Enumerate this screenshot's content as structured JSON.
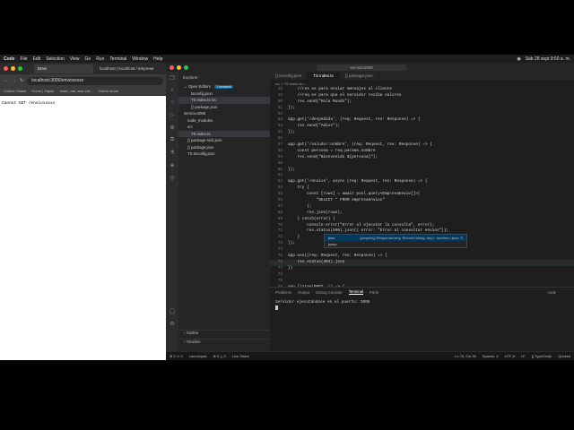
{
  "menubar": {
    "items": [
      "Code",
      "File",
      "Edit",
      "Selection",
      "View",
      "Go",
      "Run",
      "Terminal",
      "Window",
      "Help"
    ],
    "clock": "Sáb 28 sept 9:50 a. m."
  },
  "browser": {
    "tabs": [
      "Error",
      "localhost | localhost / emprese"
    ],
    "url": "localhost:3000/envioxxxxx",
    "bookmarks": [
      "Culture Shake",
      "Home | Zapier",
      "react, vue, and coll...",
      "Check mode"
    ],
    "page_text": "Cannot GET /envioxxxxx"
  },
  "vscode": {
    "search": "servicio4069",
    "explorer_title": "Explorer",
    "open_editors": "Open Editors",
    "open_editors_badge": "1 unsaved",
    "tree": [
      {
        "label": "tsconfig.json",
        "indent": 14
      },
      {
        "label": "TS index.ts src",
        "indent": 14,
        "selected": true
      },
      {
        "label": "{} package.json",
        "indent": 14
      },
      {
        "label": "servicio4069",
        "indent": 6
      },
      {
        "label": "node_modules",
        "indent": 10
      },
      {
        "label": "src",
        "indent": 10
      },
      {
        "label": "TS index.ts",
        "indent": 14,
        "selected": true
      },
      {
        "label": "{} package-lock.json",
        "indent": 10
      },
      {
        "label": "{} package.json",
        "indent": 10
      },
      {
        "label": "TS tsconfig.json",
        "indent": 10
      }
    ],
    "outline": "Outline",
    "timeline": "Timeline",
    "editor_tabs": [
      "{} tsconfig.json",
      "TS index.ts",
      "{} package.json"
    ],
    "breadcrumb": "src > TS index.ts > ...",
    "code_lines": [
      {
        "n": "48",
        "t": "    //res es para enviar mensajes al cliente"
      },
      {
        "n": "49",
        "t": "    //req es para que el servidor reciba valores"
      },
      {
        "n": "50",
        "t": "    res.send(\"Hola Mundo\");"
      },
      {
        "n": "51",
        "t": "});"
      },
      {
        "n": "52",
        "t": ""
      },
      {
        "n": "53",
        "t": "app.get('/despedida', (req: Request, res: Response) => {"
      },
      {
        "n": "54",
        "t": "    res.send(\"Adios\");"
      },
      {
        "n": "55",
        "t": "});"
      },
      {
        "n": "56",
        "t": ""
      },
      {
        "n": "57",
        "t": "app.get('/saludo/:nombre', (req: Request, res: Response) => {"
      },
      {
        "n": "58",
        "t": "    const persona = req.params.nombre"
      },
      {
        "n": "59",
        "t": "    res.send(\"Bienvenido ${persona}\");"
      },
      {
        "n": "60",
        "t": ""
      },
      {
        "n": "61",
        "t": "});"
      },
      {
        "n": "62",
        "t": ""
      },
      {
        "n": "63",
        "t": "app.get('/envios', async (req: Request, res: Response) => {"
      },
      {
        "n": "64",
        "t": "    try {"
      },
      {
        "n": "65",
        "t": "        const [rows] = await pool.query<EmpresaEnvio[]>("
      },
      {
        "n": "66",
        "t": "            \"SELECT * FROM empresaenvios\""
      },
      {
        "n": "67",
        "t": "        );"
      },
      {
        "n": "68",
        "t": "        res.json(rows);"
      },
      {
        "n": "69",
        "t": "    } catch(error) {"
      },
      {
        "n": "70",
        "t": "        console.error(\"Error al ejecutar la consulta\", error);"
      },
      {
        "n": "71",
        "t": "        res.status(500).json({ error: \"Error al consultar envios\"});"
      },
      {
        "n": "72",
        "t": "    }"
      },
      {
        "n": "73",
        "t": "});"
      },
      {
        "n": "74",
        "t": ""
      },
      {
        "n": "75",
        "t": "app.use((req: Request, res: Response) => {"
      },
      {
        "n": "76",
        "t": "    res.status(404).json"
      },
      {
        "n": "77",
        "t": "})"
      },
      {
        "n": "78",
        "t": ""
      },
      {
        "n": "79",
        "t": ""
      },
      {
        "n": "80",
        "t": "app.listen(PORT, () => {"
      },
      {
        "n": "81",
        "t": "    console.log(`Servidor ejecutándose en el puerto: ${PORT}`);"
      },
      {
        "n": "82",
        "t": "});"
      }
    ],
    "suggest": [
      {
        "label": "json",
        "detail": "(property) Response<any, Record<string, any>, number>.json: S"
      },
      {
        "label": "jsonp",
        "detail": ""
      }
    ],
    "panel_tabs": [
      "Problems",
      "Output",
      "Debug Console",
      "Terminal",
      "Ports"
    ],
    "active_panel_tab": "Terminal",
    "terminal_shell": "node",
    "terminal_output": "Servidor ejecutándose en el puerto: 3000",
    "status": {
      "left": [
        "⊗ 0 ⚠ 0",
        "Launchpad",
        "⊗ 0 △ 0",
        "Live Share"
      ],
      "right": [
        "Ln 76, Col 35",
        "Spaces: 4",
        "UTF-8",
        "LF",
        "{} TypeScript",
        "Quokka"
      ]
    }
  }
}
